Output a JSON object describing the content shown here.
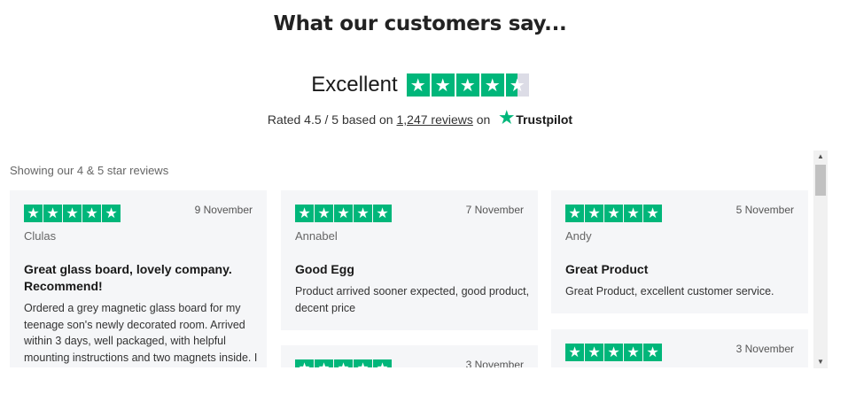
{
  "heading": "What our customers say...",
  "summary": {
    "label": "Excellent",
    "rating_stars": 4.5,
    "rated_prefix": "Rated 4.5 / 5 based on",
    "reviews_link": "1,247 reviews",
    "on_text": "on",
    "brand": "Trustpilot"
  },
  "widget": {
    "showing_text": "Showing our 4 & 5 star reviews",
    "reviews": [
      {
        "date": "9 November",
        "author": "Clulas",
        "title": "Great glass board, lovely company. Recommend!",
        "body": "Ordered a grey magnetic glass board for my teenage son's newly decorated room. Arrived within 3 days, well packaged, with helpful mounting instructions and two magnets inside. I only rarely post reviews with th..."
      },
      {
        "date": "7 November",
        "author": "Annabel",
        "title": "Good Egg",
        "body": "Product arrived sooner expected, good product, decent price"
      },
      {
        "date": "5 November",
        "author": "Andy",
        "title": "Great Product",
        "body": "Great Product, excellent customer service."
      },
      {
        "date": "3 November",
        "author": "",
        "title": "",
        "body": ""
      },
      {
        "date": "3 November",
        "author": "",
        "title": "",
        "body": ""
      }
    ]
  },
  "colors": {
    "trustpilot_green": "#00b67a",
    "card_bg": "#f5f6f8",
    "star_empty": "#dcdce6"
  }
}
